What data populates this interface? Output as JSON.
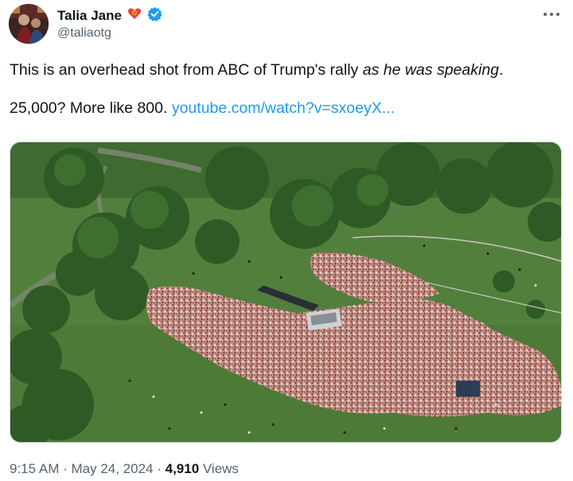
{
  "author": {
    "display_name": "Talia Jane",
    "handle": "@taliaotg",
    "verified": true
  },
  "tweet": {
    "text_prefix": "This is an overhead shot from ABC of Trump's rally ",
    "text_italic": "as he was speaking",
    "text_suffix": ".",
    "line2_text": "25,000? More like 800. ",
    "link_text": "youtube.com/watch?v=sxoeyX..."
  },
  "meta": {
    "time": "9:15 AM",
    "separator1": " · ",
    "date": "May 24, 2024",
    "separator2": " · ",
    "views_count": "4,910",
    "views_label": " Views"
  },
  "icons": {
    "emoji": "rose-heart-emoji-icon",
    "verified": "verified-badge-icon",
    "more": "more-options-icon"
  },
  "colors": {
    "link": "#1d9bf0",
    "verified": "#1d9bf0",
    "secondary_text": "#536471",
    "grass": "#4f7d3b",
    "crowd": "#b98072"
  }
}
